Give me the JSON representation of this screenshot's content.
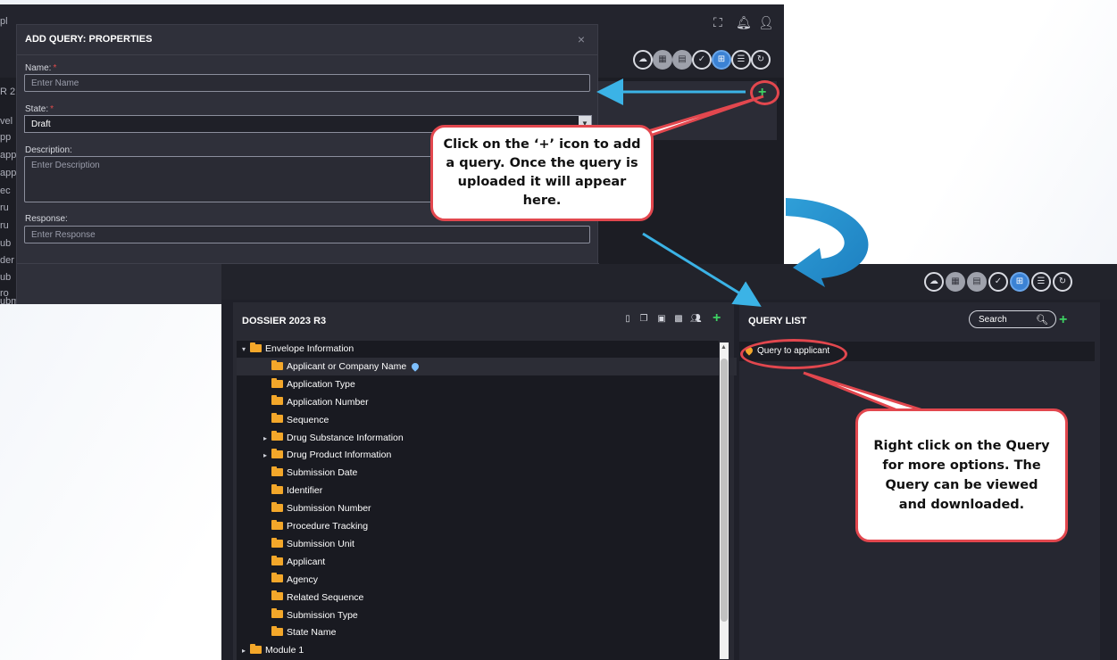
{
  "modal": {
    "title": "ADD QUERY: PROPERTIES",
    "close": "×",
    "name_label": "Name:",
    "name_placeholder": "Enter Name",
    "state_label": "State:",
    "state_value": "Draft",
    "description_label": "Description:",
    "description_placeholder": "Enter Description",
    "response_label": "Response:",
    "response_placeholder": "Enter Response",
    "required_mark": "*"
  },
  "background_fragments": [
    "pl",
    "R 2",
    "vel",
    "pp",
    "app",
    "app",
    "ec",
    "ru",
    "ru",
    "ub",
    "der",
    "ub",
    "ro",
    "ub"
  ],
  "background_bottom": "ubmission Unit",
  "dossier": {
    "title": "DOSSIER 2023 R3",
    "tree": [
      {
        "label": "Envelope Information",
        "level": 0,
        "toggle": "▾"
      },
      {
        "label": "Applicant or Company Name",
        "level": 1,
        "toggle": "",
        "selected": true,
        "pinned": true
      },
      {
        "label": "Application Type",
        "level": 1,
        "toggle": ""
      },
      {
        "label": "Application Number",
        "level": 1,
        "toggle": ""
      },
      {
        "label": "Sequence",
        "level": 1,
        "toggle": ""
      },
      {
        "label": "Drug Substance Information",
        "level": 1,
        "toggle": "▸"
      },
      {
        "label": "Drug Product Information",
        "level": 1,
        "toggle": "▸"
      },
      {
        "label": "Submission Date",
        "level": 1,
        "toggle": ""
      },
      {
        "label": "Identifier",
        "level": 1,
        "toggle": ""
      },
      {
        "label": "Submission Number",
        "level": 1,
        "toggle": ""
      },
      {
        "label": "Procedure Tracking",
        "level": 1,
        "toggle": ""
      },
      {
        "label": "Submission Unit",
        "level": 1,
        "toggle": ""
      },
      {
        "label": "Applicant",
        "level": 1,
        "toggle": ""
      },
      {
        "label": "Agency",
        "level": 1,
        "toggle": ""
      },
      {
        "label": "Related Sequence",
        "level": 1,
        "toggle": ""
      },
      {
        "label": "Submission Type",
        "level": 1,
        "toggle": ""
      },
      {
        "label": "State Name",
        "level": 1,
        "toggle": ""
      },
      {
        "label": "Module 1",
        "level": 0,
        "toggle": "▸"
      }
    ]
  },
  "query_list": {
    "title": "QUERY LIST",
    "search_placeholder": "Search",
    "items": [
      "Query to applicant"
    ]
  },
  "callouts": {
    "add_query": "Click on the ‘+’ icon to add a query. Once the query is uploaded it will appear here.",
    "right_click": "Right click on the Query for more options. The Query can be viewed and downloaded."
  },
  "colors": {
    "accent_green": "#3dd162",
    "callout_border": "#e2474e",
    "arrow_blue": "#3bb3e6",
    "folder": "#f3a72a"
  },
  "icons": [
    "expand-icon",
    "bell-icon",
    "user-icon",
    "cloud-upload-icon",
    "grid-icon",
    "clipboard-icon",
    "check-circle-icon",
    "hierarchy-icon",
    "table-icon",
    "refresh-icon",
    "plus-icon",
    "search-icon",
    "pin-icon",
    "folder-icon"
  ]
}
